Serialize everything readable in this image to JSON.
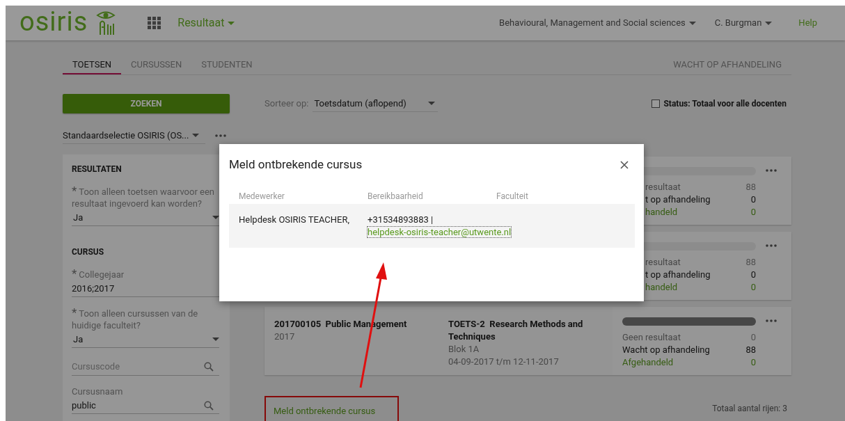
{
  "header": {
    "logo": "osiris",
    "app_menu": "Resultaat",
    "faculty_menu": "Behavioural, Management and Social sciences",
    "user_menu": "C. Burgman",
    "help": "Help"
  },
  "tabs": [
    {
      "label": "TOETSEN",
      "selected": true
    },
    {
      "label": "CURSUSSEN",
      "selected": false
    },
    {
      "label": "STUDENTEN",
      "selected": false
    }
  ],
  "right_tab": {
    "label": "WACHT OP AFHANDELING",
    "selected": false
  },
  "search_button": "ZOEKEN",
  "selection": {
    "value": "Standaardselectie OSIRIS (OS..."
  },
  "sort": {
    "label": "Sorteer op:",
    "value": "Toetsdatum (aflopend)"
  },
  "status_filter": {
    "label": "Status: Totaal voor alle docenten",
    "checked": false
  },
  "sidebar": [
    {
      "heading": "RESULTATEN",
      "fields": [
        {
          "kind": "select",
          "label": "Toon alleen toetsen waarvoor een resultaat ingevoerd kan worden?",
          "mark": "*",
          "value": "Ja"
        }
      ]
    },
    {
      "heading": "CURSUS",
      "fields": [
        {
          "kind": "text",
          "label": "Collegejaar",
          "mark": "*",
          "value": "2016;2017"
        },
        {
          "kind": "select",
          "label": "Toon alleen cursussen van de huidige faculteit?",
          "mark": "*",
          "value": "Ja"
        },
        {
          "kind": "search",
          "placeholder": "Cursuscode"
        },
        {
          "kind": "search",
          "label": "Cursusnaam",
          "value": "public"
        }
      ]
    }
  ],
  "cards": [
    {
      "color": "#8c8c8c",
      "status": [
        {
          "kind": "none",
          "label": "resultaat",
          "count": "88"
        },
        {
          "kind": "waiting",
          "label": "t op afhandeling",
          "count": "0"
        },
        {
          "kind": "done",
          "label": "handeld",
          "count": "0"
        }
      ]
    },
    {
      "color": "#8c8c8c",
      "status": [
        {
          "kind": "none",
          "label": "resultaat",
          "count": "88"
        },
        {
          "kind": "waiting",
          "label": "t op afhandeling",
          "count": "0"
        },
        {
          "kind": "done",
          "label": "handeld",
          "count": "0"
        }
      ]
    },
    {
      "course_code": "201700105",
      "course_name": "Public Management",
      "year": "2017",
      "test_code": "TOETS-2",
      "test_name": "Research Methods and Techniques",
      "block": "Blok 1A",
      "period": "04-09-2017 t/m 12-11-2017",
      "color": "#474747",
      "status": [
        {
          "kind": "none",
          "label": "Geen resultaat",
          "count": "0"
        },
        {
          "kind": "waiting",
          "label": "Wacht op afhandeling",
          "count": "88"
        },
        {
          "kind": "done",
          "label": "Afgehandeld",
          "count": "0"
        }
      ]
    }
  ],
  "footer": {
    "link": "Meld ontbrekende cursus",
    "total": "Totaal aantal rijen: 3"
  },
  "modal": {
    "title": "Meld ontbrekende cursus",
    "columns": [
      "Medewerker",
      "Bereikbaarheid",
      "Faculteit"
    ],
    "rows": [
      {
        "employee": "Helpdesk OSIRIS TEACHER,",
        "phone": "+31534893883 |",
        "email": "helpdesk-osiris-teacher@utwente.nl"
      }
    ]
  }
}
